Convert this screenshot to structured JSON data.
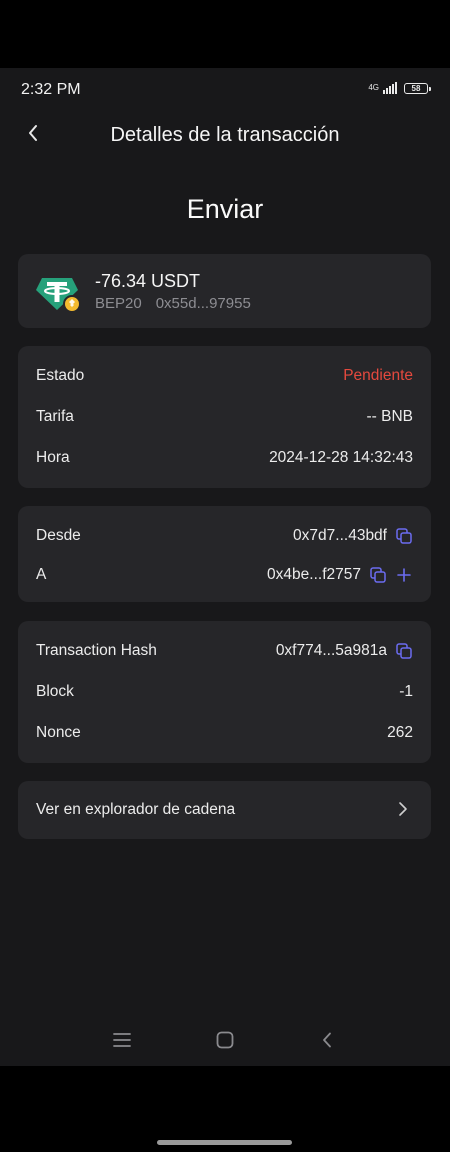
{
  "status_bar": {
    "time": "2:32 PM",
    "network": "4G",
    "battery": "58"
  },
  "header": {
    "title": "Detalles de la transacción"
  },
  "transaction": {
    "type_title": "Enviar",
    "amount": "-76.34 USDT",
    "network": "BEP20",
    "contract_short": "0x55d...97955"
  },
  "info": {
    "status_label": "Estado",
    "status_value": "Pendiente",
    "fee_label": "Tarifa",
    "fee_value": "-- BNB",
    "time_label": "Hora",
    "time_value": "2024-12-28 14:32:43"
  },
  "addresses": {
    "from_label": "Desde",
    "from_value": "0x7d7...43bdf",
    "to_label": "A",
    "to_value": "0x4be...f2757"
  },
  "chain": {
    "hash_label": "Transaction Hash",
    "hash_value": "0xf774...5a981a",
    "block_label": "Block",
    "block_value": "-1",
    "nonce_label": "Nonce",
    "nonce_value": "262"
  },
  "explorer": {
    "label": "Ver en explorador de cadena"
  },
  "colors": {
    "background": "#18181a",
    "card": "#262629",
    "pending": "#e5493e",
    "accent": "#6b6cf0",
    "tether": "#26a17b",
    "bnb": "#f3ba2f"
  },
  "icons": {
    "back": "back-arrow-icon",
    "copy": "copy-icon",
    "plus": "plus-icon",
    "chevron": "chevron-right-icon",
    "token": "usdt-token-icon",
    "chain_badge": "bnb-badge-icon",
    "nav_menu": "menu-icon",
    "nav_home": "home-square-icon",
    "nav_back": "nav-back-icon"
  }
}
